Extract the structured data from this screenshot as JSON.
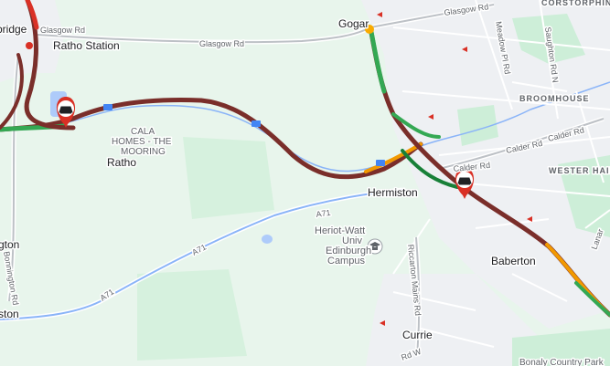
{
  "map": {
    "places": {
      "ratho_station": "Ratho Station",
      "ratho": "Ratho",
      "cala_homes_1": "CALA",
      "cala_homes_2": "HOMES - THE",
      "cala_homes_3": "MOORING",
      "hermiston": "Hermiston",
      "baberton": "Baberton",
      "currie": "Currie",
      "broomhouse": "BROOMHOUSE",
      "wester_hailes": "WESTER HAILES",
      "corstorphine": "CORSTORPHINE",
      "gogar": "Gogar",
      "bridge_partial": "bridge",
      "edge_gton": "gton",
      "edge_ston": "ston",
      "campus_1": "Heriot-Watt",
      "campus_2": "Univ",
      "campus_3": "Edinburgh",
      "campus_4": "Campus",
      "bonaly": "Bonaly Country Park"
    },
    "roads": {
      "glasgow_rd_1": "Glasgow Rd",
      "glasgow_rd_2": "Glasgow Rd",
      "glasgow_rd_3": "Glasgow Rd",
      "calder_rd_1": "Calder Rd",
      "calder_rd_2": "Calder Rd",
      "calder_rd_3": "Calder Rd",
      "a71_1": "A71",
      "a71_2": "A71",
      "a71_3": "A71",
      "meadow_pl_rd": "Meadow Pl Rd",
      "saughton_rd_n": "Saughton Rd N",
      "riccarton_mains_rd": "Riccarton Mains Rd",
      "bonnington_rd": "Bonnington Rd",
      "lanark": "Lanar",
      "rd_w": "Rd W"
    },
    "icons": {
      "incident_1": "car-crash-icon",
      "incident_2": "car-crash-icon",
      "campus_marker": "graduation-cap-icon",
      "rail_station": "rail-icon"
    },
    "colors": {
      "land": "#e8f5ec",
      "park": "#c8ecd2",
      "traffic_heavy": "#7a2e2a",
      "traffic_slow": "#d93025",
      "traffic_moderate": "#f29900",
      "traffic_free": "#188038",
      "traffic_light": "#34a853",
      "incident": "#d93025"
    }
  }
}
